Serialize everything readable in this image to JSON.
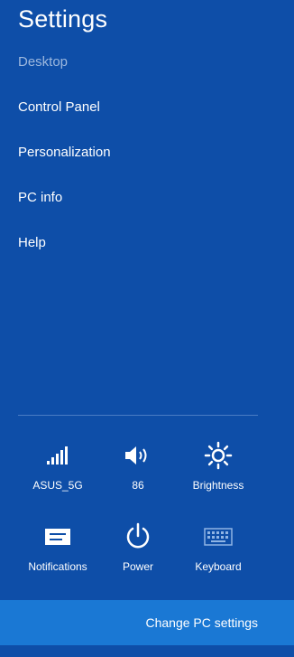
{
  "charm": {
    "title": "Settings",
    "context": "Desktop"
  },
  "menu": [
    {
      "label": "Control Panel"
    },
    {
      "label": "Personalization"
    },
    {
      "label": "PC info"
    },
    {
      "label": "Help"
    }
  ],
  "tiles": [
    {
      "label": "ASUS_5G",
      "icon": "wifi-signal-icon"
    },
    {
      "label": "86",
      "icon": "volume-icon"
    },
    {
      "label": "Brightness",
      "icon": "brightness-icon"
    },
    {
      "label": "Notifications",
      "icon": "notifications-icon"
    },
    {
      "label": "Power",
      "icon": "power-icon"
    },
    {
      "label": "Keyboard",
      "icon": "keyboard-icon"
    }
  ],
  "footer": {
    "label": "Change PC settings"
  },
  "colors": {
    "background": "#0e4ea8",
    "footer": "#1a78d4",
    "muted_text": "#9db8de",
    "keyboard_icon": "#8fb4e4"
  }
}
